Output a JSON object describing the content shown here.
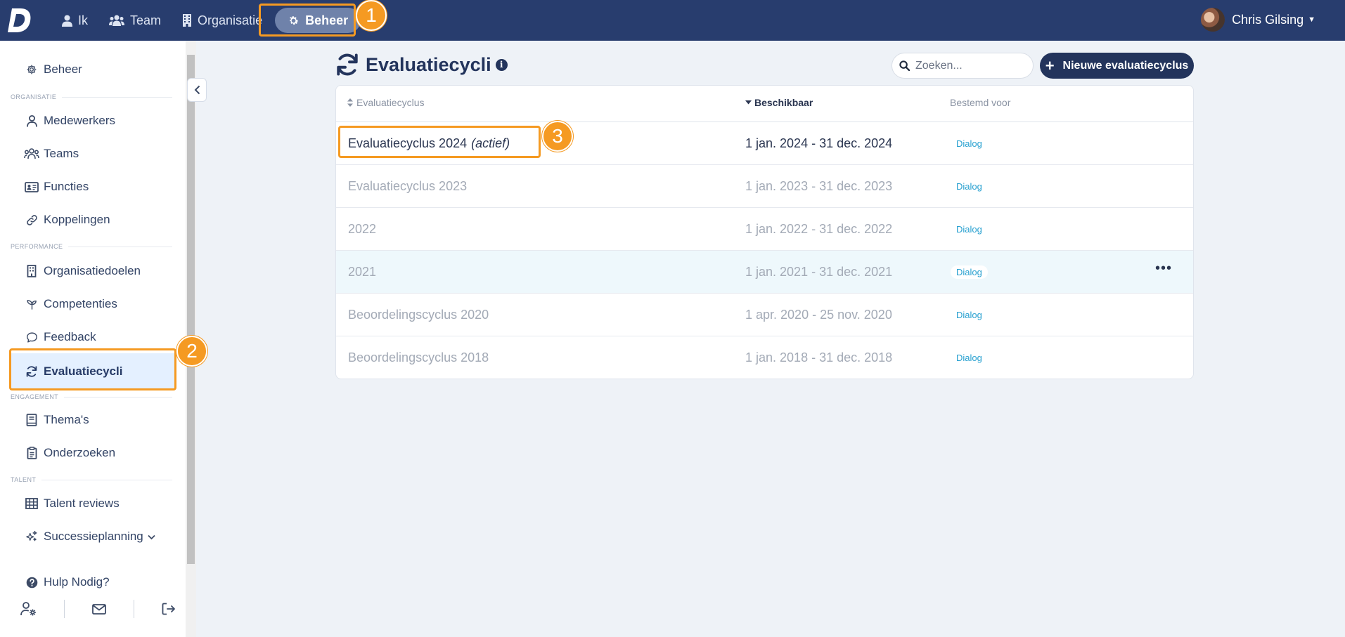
{
  "topbar": {
    "logo": "D",
    "nav": [
      {
        "label": "Ik",
        "icon": "user-icon"
      },
      {
        "label": "Team",
        "icon": "users-icon"
      },
      {
        "label": "Organisatie",
        "icon": "building-icon"
      },
      {
        "label": "Beheer",
        "icon": "gear-icon"
      }
    ],
    "user_name": "Chris Gilsing"
  },
  "sidebar": {
    "beheer": "Beheer",
    "sections": {
      "organisatie": "ORGANISATIE",
      "performance": "PERFORMANCE",
      "engagement": "ENGAGEMENT",
      "talent": "TALENT"
    },
    "items": {
      "medewerkers": "Medewerkers",
      "teams": "Teams",
      "functies": "Functies",
      "koppelingen": "Koppelingen",
      "organisatiedoelen": "Organisatiedoelen",
      "competenties": "Competenties",
      "feedback": "Feedback",
      "evaluatiecycli": "Evaluatiecycli",
      "themas": "Thema's",
      "onderzoeken": "Onderzoeken",
      "talent_reviews": "Talent reviews",
      "successieplanning": "Successieplanning"
    },
    "help": "Hulp Nodig?"
  },
  "main": {
    "title": "Evaluatiecycli",
    "search_placeholder": "Zoeken...",
    "new_button": "Nieuwe evaluatiecyclus",
    "columns": {
      "name": "Evaluatiecyclus",
      "available": "Beschikbaar",
      "intended": "Bestemd voor"
    },
    "rows": [
      {
        "name": "Evaluatiecyclus 2024",
        "status": "(actief)",
        "period": "1 jan. 2024 - 31 dec. 2024",
        "badge": "Dialog"
      },
      {
        "name": "Evaluatiecyclus 2023",
        "period": "1 jan. 2023 - 31 dec. 2023",
        "badge": "Dialog"
      },
      {
        "name": "2022",
        "period": "1 jan. 2022 - 31 dec. 2022",
        "badge": "Dialog"
      },
      {
        "name": "2021",
        "period": "1 jan. 2021 - 31 dec. 2021",
        "badge": "Dialog",
        "more": "•••"
      },
      {
        "name": "Beoordelingscyclus 2020",
        "period": "1 apr. 2020 - 25 nov. 2020",
        "badge": "Dialog"
      },
      {
        "name": "Beoordelingscyclus 2018",
        "period": "1 jan. 2018 - 31 dec. 2018",
        "badge": "Dialog"
      }
    ]
  },
  "annotations": [
    "1",
    "2",
    "3"
  ],
  "colors": {
    "topbar": "#283d6e",
    "accent": "#f59a22",
    "primary": "#23345c",
    "badge": "#27a0d0"
  }
}
